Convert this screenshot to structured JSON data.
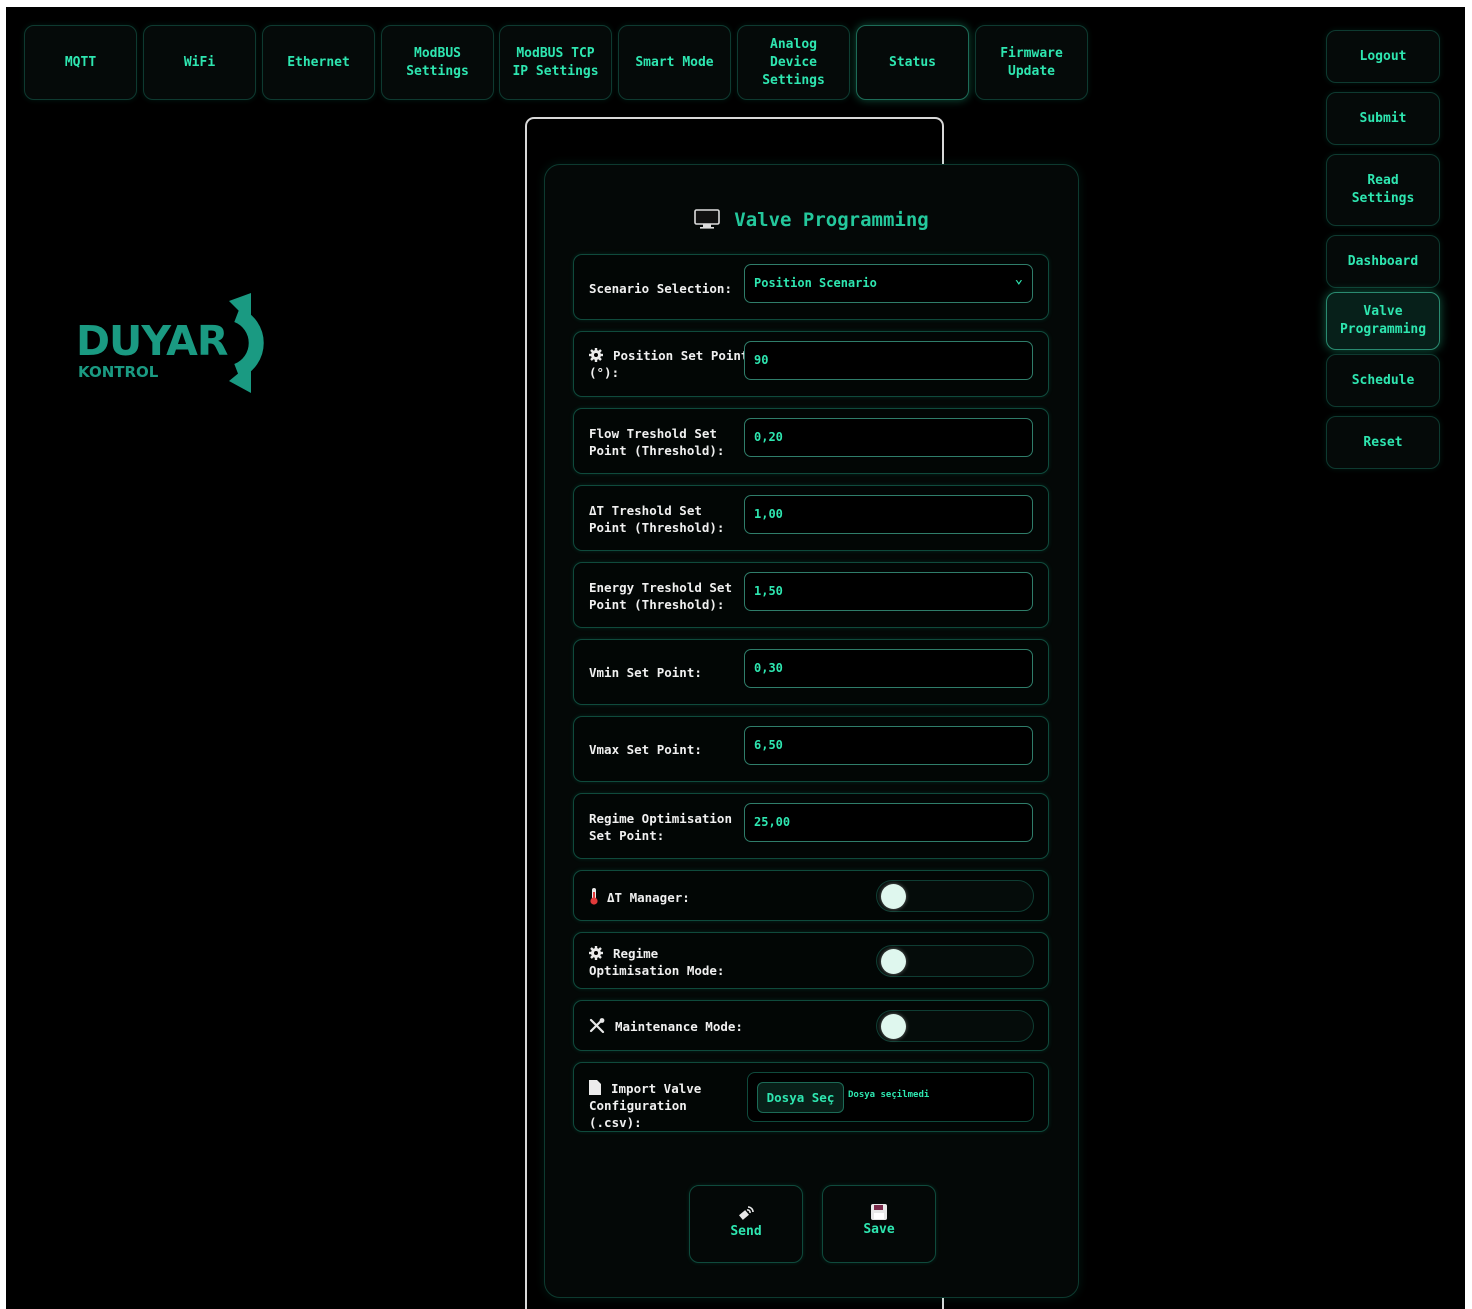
{
  "top_tabs": [
    "MQTT",
    "WiFi",
    "Ethernet",
    "ModBUS\nSettings",
    "ModBUS TCP\nIP Settings",
    "Smart Mode",
    "Analog\nDevice\nSettings",
    "Status",
    "Firmware\nUpdate"
  ],
  "active_top_tab": "Status",
  "side_menu": [
    "Logout",
    "Submit",
    "Read\nSettings",
    "Dashboard",
    "Valve\nProgramming",
    "Schedule",
    "Reset"
  ],
  "active_side_item": "Valve\nProgramming",
  "logo": {
    "word": "DUYAR",
    "sub": "KONTROL"
  },
  "panel": {
    "title": "Valve Programming",
    "title_icon": "monitor-icon",
    "scenario": {
      "label": "Scenario Selection:",
      "value": "Position Scenario"
    },
    "fields": [
      {
        "label": "Position Set Point (°):",
        "value": "90",
        "icon": "gear-icon"
      },
      {
        "label": "Flow Treshold Set Point (Threshold):",
        "value": "0,20"
      },
      {
        "label": "ΔT Treshold Set Point (Threshold):",
        "value": "1,00"
      },
      {
        "label": "Energy Treshold Set Point (Threshold):",
        "value": "1,50"
      },
      {
        "label": "Vmin Set Point:",
        "value": "0,30"
      },
      {
        "label": "Vmax Set Point:",
        "value": "6,50"
      },
      {
        "label": "Regime Optimisation Set Point:",
        "value": "25,00"
      }
    ],
    "toggles": [
      {
        "label": "ΔT Manager:",
        "icon": "thermometer-icon",
        "on": false
      },
      {
        "label": "Regime Optimisation Mode:",
        "icon": "gear-icon",
        "on": false
      },
      {
        "label": "Maintenance Mode:",
        "icon": "tools-icon",
        "on": false
      }
    ],
    "import": {
      "label": "Import Valve Configuration (.csv):",
      "icon": "document-icon",
      "button": "Dosya Seç",
      "status": "Dosya seçilmedi"
    },
    "actions": {
      "send": "Send",
      "save": "Save"
    }
  },
  "colors": {
    "accent": "#2ee6b0",
    "logo": "#1a9a82",
    "background": "#000000"
  }
}
